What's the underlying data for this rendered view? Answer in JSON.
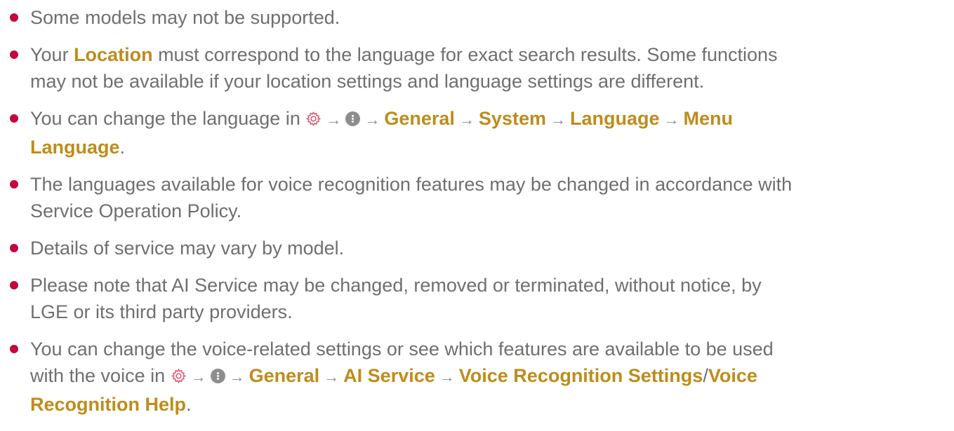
{
  "notes": {
    "n1": {
      "text": "Some models may not be supported."
    },
    "n2": {
      "pre": "Your ",
      "hl": "Location",
      "line1_post": " must correspond to the language for exact search results. Some functions",
      "line2": "may not be available if your location settings and language settings are different."
    },
    "n3": {
      "pre": "You can change the language in ",
      "path": [
        "General",
        "System",
        "Language"
      ],
      "last_part1": "Menu",
      "last_part2": "Language",
      "post": "."
    },
    "n4": {
      "line1": "The languages available for voice recognition features may be changed in accordance with",
      "line2": "Service Operation Policy."
    },
    "n5": {
      "text": "Details of service may vary by model."
    },
    "n6": {
      "line1": "Please note that AI Service may be changed, removed or terminated, without notice, by",
      "line2": "LGE or its third party providers."
    },
    "n7": {
      "line1": "You can change the voice-related settings or see which features are available to be used",
      "pre2": "with the voice in ",
      "path": [
        "General",
        "AI Service"
      ],
      "last_a": "Voice Recognition Settings",
      "sep": "/",
      "last_b_part1": "Voice",
      "last_b_part2": "Recognition Help",
      "post": "."
    }
  },
  "arrow": "→",
  "icons": {
    "settings": "gear-icon",
    "more": "more-options-icon"
  },
  "colors": {
    "text": "#6f6f6f",
    "highlight": "#be8c1c",
    "bullet": "#c3073f",
    "icon_gear": "#e2556f",
    "icon_more": "#8d8d8d"
  }
}
